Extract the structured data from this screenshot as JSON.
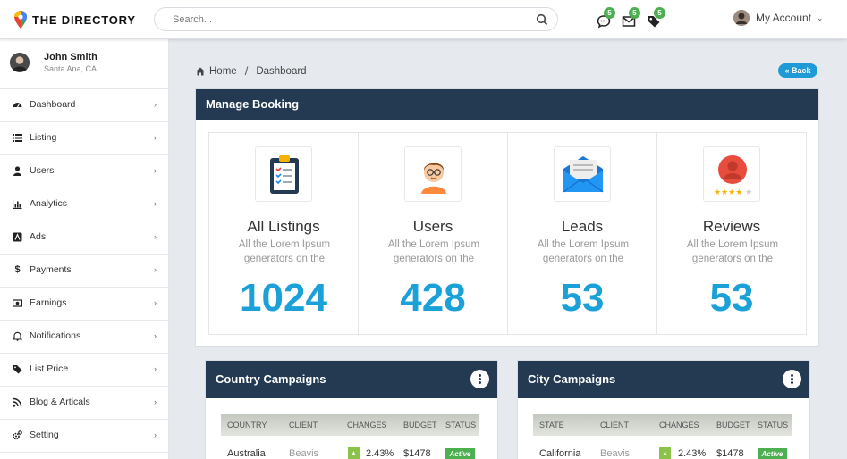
{
  "header": {
    "logo_text": "THE DIRECTORY",
    "search_placeholder": "Search...",
    "badges": {
      "messages": "5",
      "mail": "5",
      "tags": "5"
    },
    "account_label": "My Account"
  },
  "sidebar": {
    "profile": {
      "name": "John Smith",
      "location": "Santa Ana, CA"
    },
    "items": [
      {
        "label": "Dashboard",
        "icon": "dashboard-icon"
      },
      {
        "label": "Listing",
        "icon": "list-icon"
      },
      {
        "label": "Users",
        "icon": "user-icon"
      },
      {
        "label": "Analytics",
        "icon": "bar-chart-icon"
      },
      {
        "label": "Ads",
        "icon": "ads-icon"
      },
      {
        "label": "Payments",
        "icon": "dollar-icon"
      },
      {
        "label": "Earnings",
        "icon": "money-icon"
      },
      {
        "label": "Notifications",
        "icon": "bell-icon"
      },
      {
        "label": "List Price",
        "icon": "tag-icon"
      },
      {
        "label": "Blog & Articals",
        "icon": "rss-icon"
      },
      {
        "label": "Setting",
        "icon": "gear-icon"
      }
    ]
  },
  "breadcrumb": {
    "home": "Home",
    "current": "Dashboard"
  },
  "back_label": "Back",
  "manage_booking": {
    "title": "Manage Booking",
    "stats": [
      {
        "title": "All Listings",
        "desc": "All the Lorem Ipsum generators on the",
        "value": "1024",
        "icon": "clipboard-icon"
      },
      {
        "title": "Users",
        "desc": "All the Lorem Ipsum generators on the",
        "value": "428",
        "icon": "user-avatar-icon"
      },
      {
        "title": "Leads",
        "desc": "All the Lorem Ipsum generators on the",
        "value": "53",
        "icon": "envelope-icon"
      },
      {
        "title": "Reviews",
        "desc": "All the Lorem Ipsum generators on the",
        "value": "53",
        "icon": "reviews-icon"
      }
    ]
  },
  "country_campaigns": {
    "title": "Country Campaigns",
    "columns": [
      "COUNTRY",
      "CLIENT",
      "CHANGES",
      "BUDGET",
      "STATUS"
    ],
    "rows": [
      {
        "place": "Australia",
        "client": "Beavis",
        "change": "2.43%",
        "budget": "$1478",
        "status": "Active"
      }
    ]
  },
  "city_campaigns": {
    "title": "City Campaigns",
    "columns": [
      "STATE",
      "CLIENT",
      "CHANGES",
      "BUDGET",
      "STATUS"
    ],
    "rows": [
      {
        "place": "California",
        "client": "Beavis",
        "change": "2.43%",
        "budget": "$1478",
        "status": "Active"
      }
    ]
  },
  "colors": {
    "navy": "#243a52",
    "accent": "#1ba1d8",
    "green": "#4caf50"
  }
}
